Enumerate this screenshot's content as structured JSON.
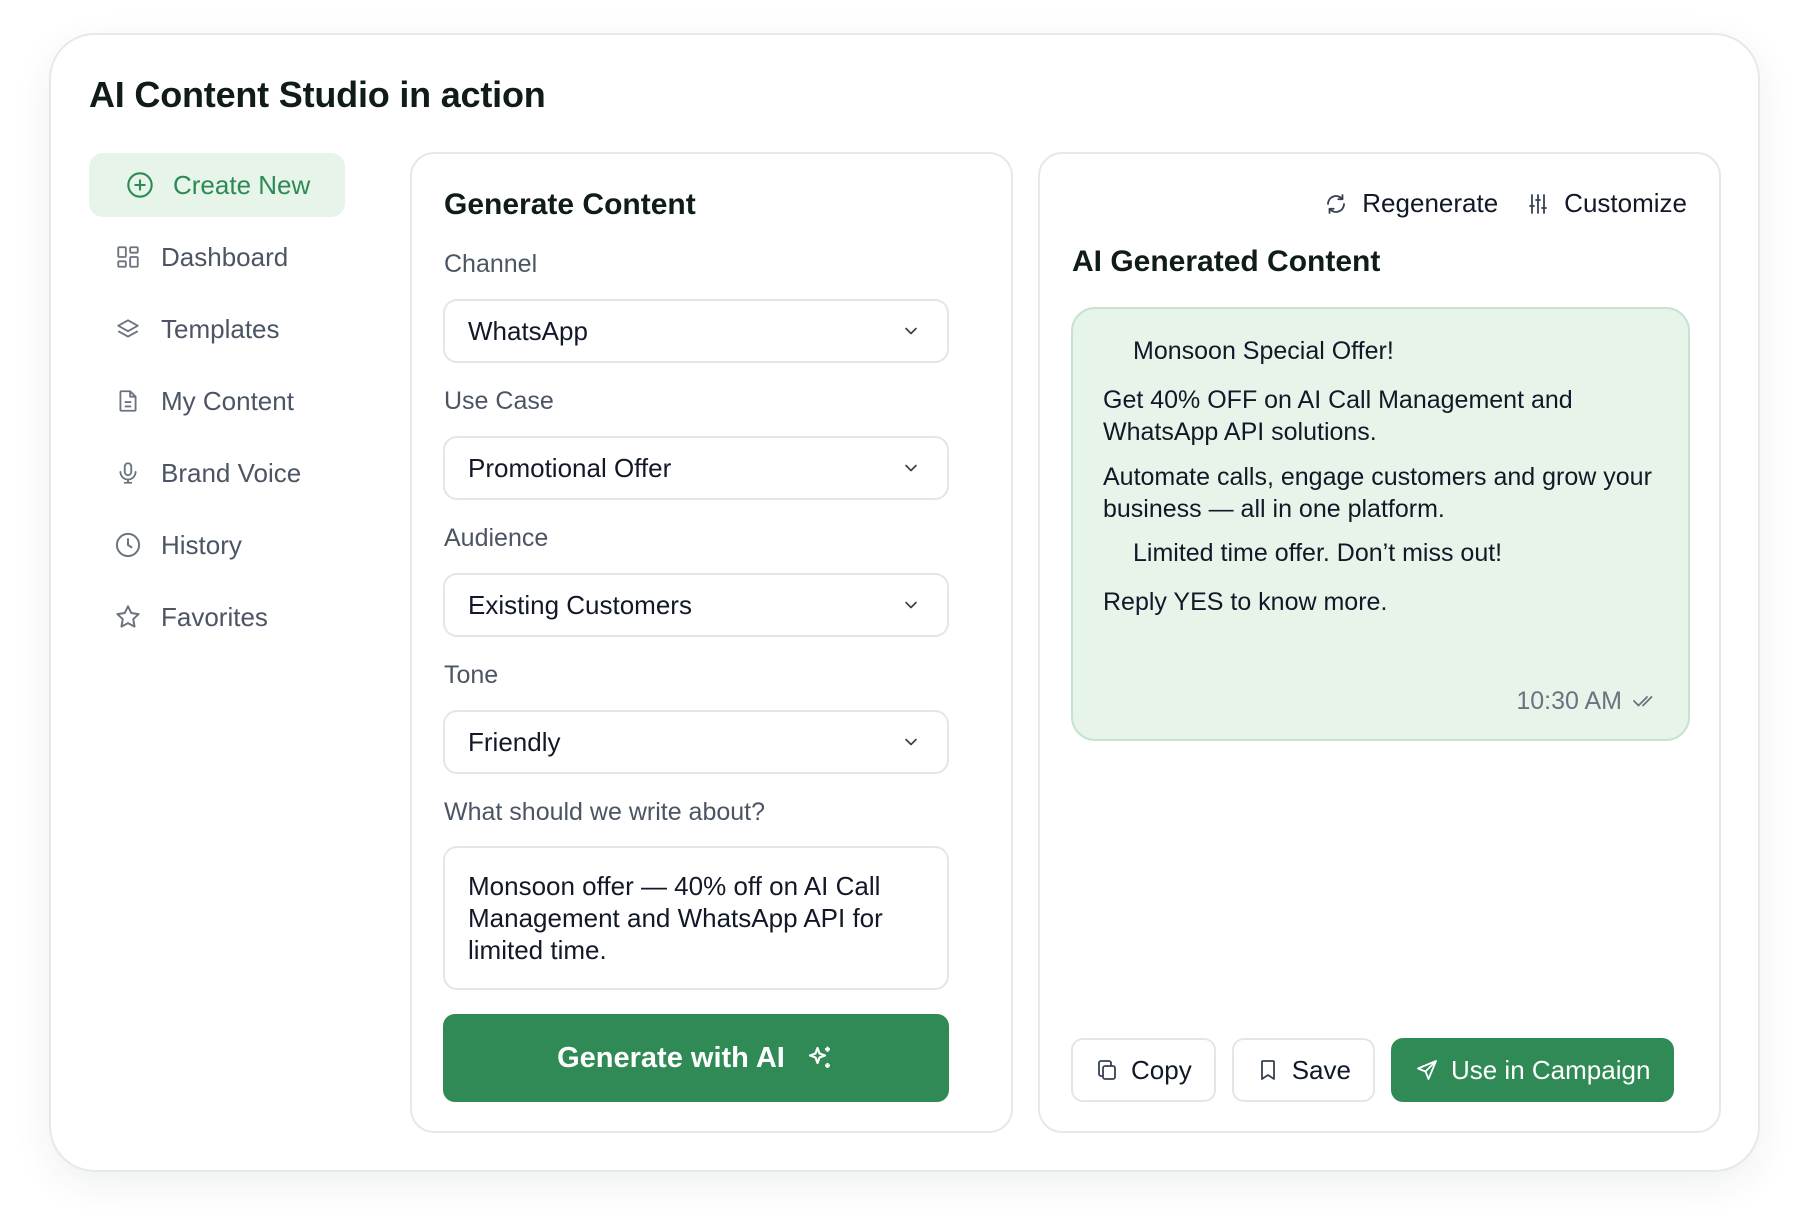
{
  "page": {
    "title": "AI Content Studio in action"
  },
  "sidebar": {
    "items": [
      {
        "label": "Create New",
        "icon": "plus-circle-icon",
        "active": true
      },
      {
        "label": "Dashboard",
        "icon": "dashboard-grid-icon"
      },
      {
        "label": "Templates",
        "icon": "layers-icon"
      },
      {
        "label": "My Content",
        "icon": "document-icon"
      },
      {
        "label": "Brand Voice",
        "icon": "microphone-icon"
      },
      {
        "label": "History",
        "icon": "clock-icon"
      },
      {
        "label": "Favorites",
        "icon": "star-icon"
      }
    ]
  },
  "generate": {
    "title": "Generate Content",
    "channel": {
      "label": "Channel",
      "value": "WhatsApp"
    },
    "use_case": {
      "label": "Use Case",
      "value": "Promotional Offer"
    },
    "audience": {
      "label": "Audience",
      "value": "Existing Customers"
    },
    "tone": {
      "label": "Tone",
      "value": "Friendly"
    },
    "prompt": {
      "label": "What should we write about?",
      "value": "Monsoon offer — 40% off on AI Call Management and WhatsApp API for limited time."
    },
    "button_label": "Generate with AI"
  },
  "output": {
    "regenerate_label": "Regenerate",
    "customize_label": "Customize",
    "title": "AI Generated Content",
    "message": {
      "line1": "Monsoon Special Offer!",
      "line2": "Get 40% OFF on AI Call Management and WhatsApp API solutions.",
      "line3": "Automate calls, engage customers and grow your business — all in one platform.",
      "line4": "Limited time offer. Don’t miss out!",
      "line5": "Reply YES to know more.",
      "time": "10:30 AM"
    },
    "actions": {
      "copy": "Copy",
      "save": "Save",
      "use": "Use in Campaign"
    }
  },
  "colors": {
    "accent": "#2f8a55",
    "active_bg": "#e6f4ea",
    "bubble_bg": "#e6f4ea",
    "border": "#e6e8ea"
  }
}
